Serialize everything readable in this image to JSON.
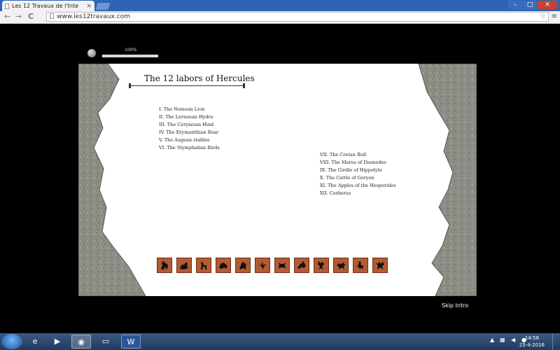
{
  "browser": {
    "tab_title": "Les 12 Travaux de l'Inte",
    "tab_close": "×",
    "nav_back": "←",
    "nav_forward": "→",
    "nav_reload": "C",
    "url": "www.les12travaux.com",
    "bookmark_star": "☆",
    "menu_icon": "≡",
    "win_minimize": "–",
    "win_maximize": "□",
    "win_close": "✕"
  },
  "loader": {
    "label": "100%",
    "progress": 1.0
  },
  "intro": {
    "title": "The 12 labors of Hercules",
    "labors_left": [
      "I. The Nemean Lion",
      "II. The Lernaean Hydra",
      "III. The Ceryneian Hind",
      "IV. The Erymanthian Boar",
      "V. The Augean stables",
      "VI. The Stymphalian Birds"
    ],
    "labors_right": [
      "VII. The Cretan Bull",
      "VIII. The Mares of Diomedes",
      "IX. The Girdle of Hippolyte",
      "X. The Cattle of Geryon",
      "XI. The Apples of the Hesperides",
      "XII. Cerberus"
    ],
    "skip_label": "Skip Intro",
    "tile_color": "#b45a32"
  },
  "taskbar": {
    "apps": [
      {
        "icon": "internet-explorer-icon",
        "glyph": "e"
      },
      {
        "icon": "media-player-icon",
        "glyph": "▶"
      },
      {
        "icon": "chrome-icon",
        "glyph": "◉"
      },
      {
        "icon": "scanner-icon",
        "glyph": "▭"
      },
      {
        "icon": "word-icon",
        "glyph": "W"
      }
    ],
    "time": "14:58",
    "date": "25-4-2016"
  }
}
